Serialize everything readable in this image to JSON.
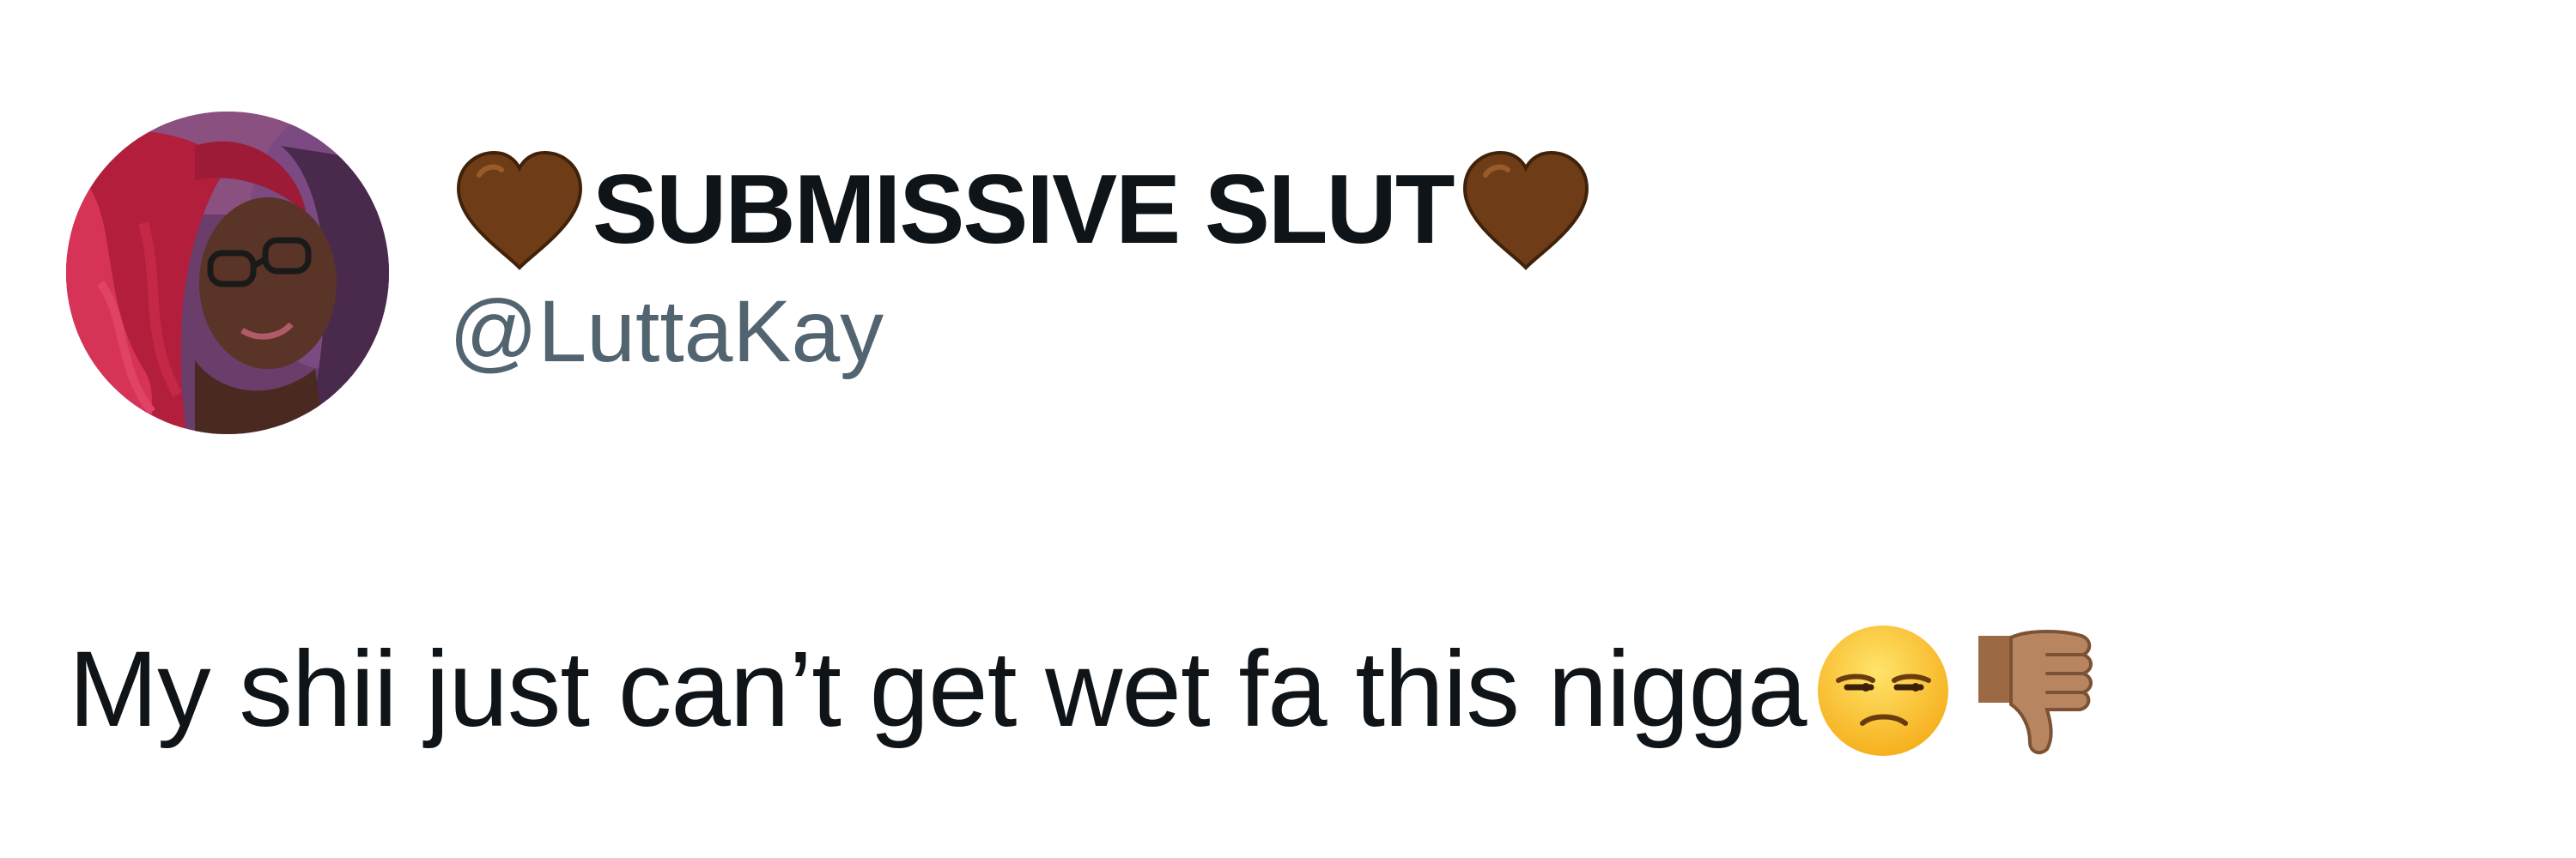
{
  "tweet": {
    "author": {
      "display_name": "SUBMISSIVE SLUT",
      "handle": "@LuttaKay",
      "name_emoji_left": "brown-heart-icon",
      "name_emoji_right": "brown-heart-icon"
    },
    "text": "My shii just can’t get wet fa this nigga",
    "text_emojis": [
      "unamused-face-icon",
      "thumbs-down-icon"
    ]
  },
  "colors": {
    "text_primary": "#0f1419",
    "text_secondary": "#536471",
    "heart_brown": "#6e3d17",
    "avatar_hair": "#c0213f"
  }
}
